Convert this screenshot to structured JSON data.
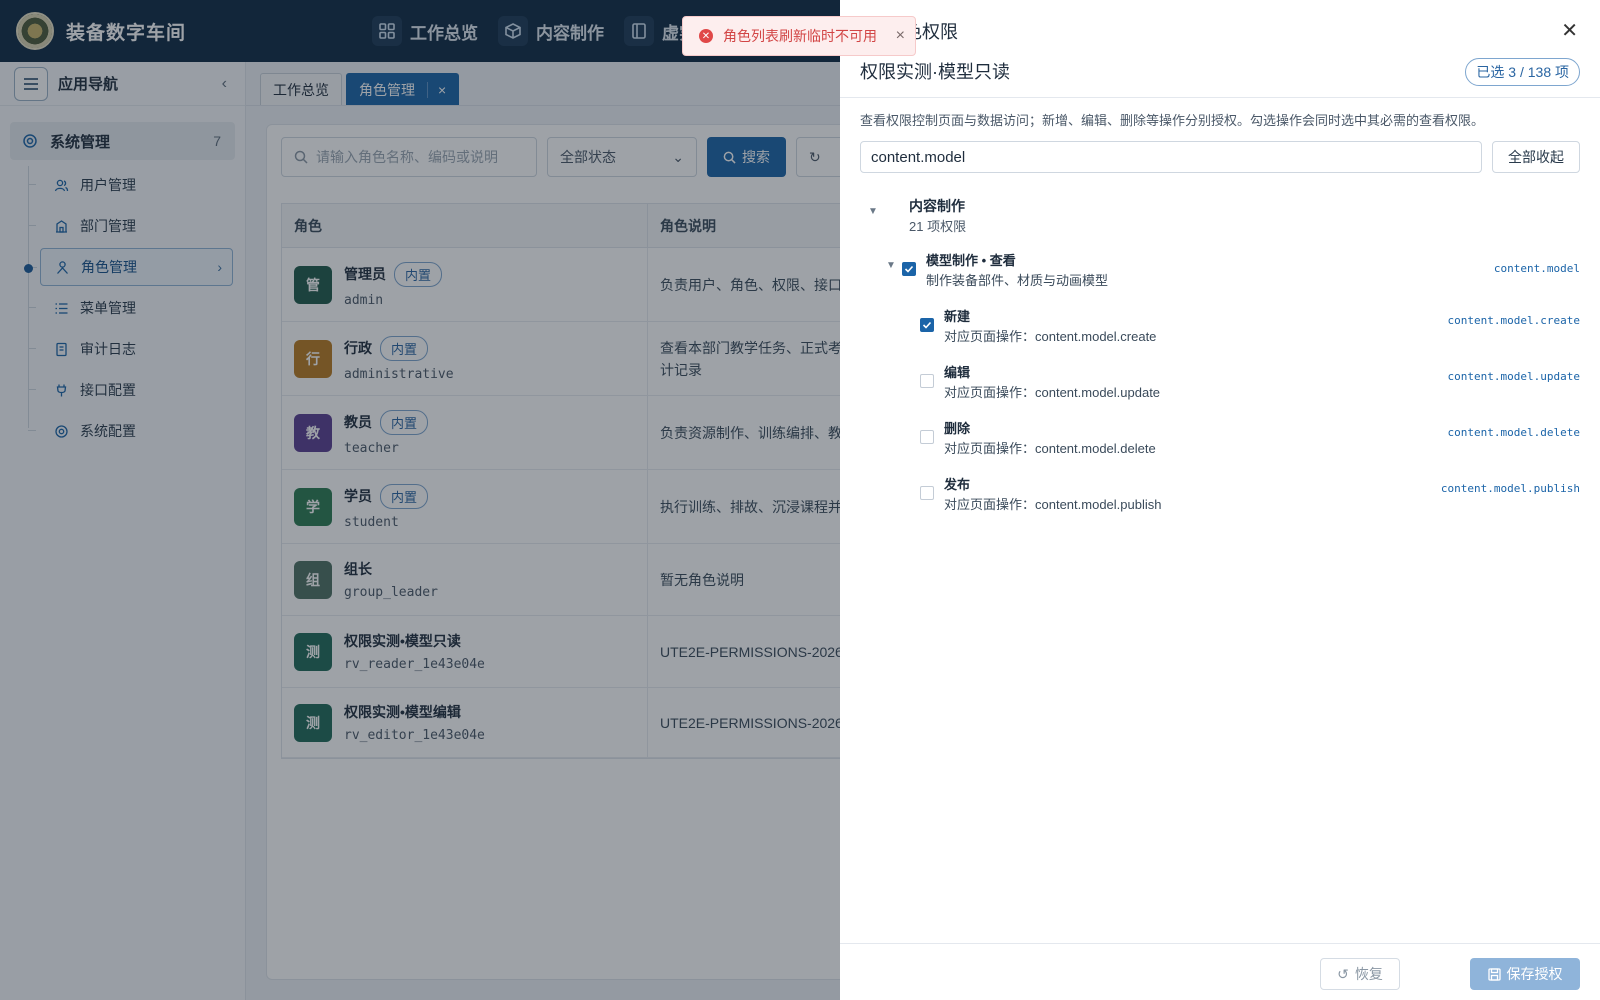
{
  "app": {
    "brand": "装备数字车间"
  },
  "topnav": [
    {
      "label": "工作总览",
      "icon": "grid-icon"
    },
    {
      "label": "内容制作",
      "icon": "cube-icon"
    },
    {
      "label": "虚实",
      "icon": "book-icon"
    }
  ],
  "sidebar": {
    "title": "应用导航",
    "group": {
      "label": "系统管理",
      "count": "7"
    },
    "items": [
      {
        "label": "用户管理",
        "icon": "users-icon"
      },
      {
        "label": "部门管理",
        "icon": "building-icon"
      },
      {
        "label": "角色管理",
        "icon": "role-icon",
        "active": true
      },
      {
        "label": "菜单管理",
        "icon": "list-icon"
      },
      {
        "label": "审计日志",
        "icon": "file-icon"
      },
      {
        "label": "接口配置",
        "icon": "plug-icon"
      },
      {
        "label": "系统配置",
        "icon": "gear-icon"
      }
    ]
  },
  "tabs": [
    {
      "label": "工作总览"
    },
    {
      "label": "角色管理",
      "active": true
    }
  ],
  "search": {
    "placeholder": "请输入角色名称、编码或说明",
    "status": "全部状态",
    "search_label": "搜索"
  },
  "table": {
    "headers": [
      "角色",
      "角色说明"
    ],
    "rows": [
      {
        "avatar": "管",
        "color": "#1f5a4a",
        "name": "管理员",
        "badge": "内置",
        "code": "admin",
        "desc": "负责用户、角色、权限、接口"
      },
      {
        "avatar": "行",
        "color": "#b87a22",
        "name": "行政",
        "badge": "内置",
        "code": "administrative",
        "desc": "查看本部门教学任务、正式考",
        "desc2": "计记录"
      },
      {
        "avatar": "教",
        "color": "#5b3f92",
        "name": "教员",
        "badge": "内置",
        "code": "teacher",
        "desc": "负责资源制作、训练编排、教"
      },
      {
        "avatar": "学",
        "color": "#2b7a52",
        "name": "学员",
        "badge": "内置",
        "code": "student",
        "desc": "执行训练、排故、沉浸课程并"
      },
      {
        "avatar": "组",
        "color": "#4e7163",
        "name": "组长",
        "badge": "",
        "code": "group_leader",
        "desc": "暂无角色说明"
      },
      {
        "avatar": "测",
        "color": "#1f6a58",
        "name": "权限实测•模型只读",
        "badge": "",
        "code": "rv_reader_1e43e04e",
        "desc": "UTE2E-PERMISSIONS-2026"
      },
      {
        "avatar": "测",
        "color": "#1f6a58",
        "name": "权限实测•模型编辑",
        "badge": "",
        "code": "rv_editor_1e43e04e",
        "desc": "UTE2E-PERMISSIONS-2026"
      }
    ]
  },
  "toast": {
    "message": "角色列表刷新临时不可用"
  },
  "drawer": {
    "title": "色权限",
    "role_name": "权限实测·模型只读",
    "selected": "已选 3 / 138 项",
    "description": "查看权限控制页面与数据访问；新增、编辑、删除等操作分别授权。勾选操作会同时选中其必需的查看权限。",
    "filter_value": "content.model",
    "collapse_all": "全部收起",
    "group": {
      "name": "内容制作",
      "count": "21 项权限"
    },
    "node": {
      "name": "模型制作 • 查看",
      "desc": "制作装备部件、材质与动画模型",
      "code": "content.model",
      "checked": true
    },
    "leaves": [
      {
        "name": "新建",
        "desc": "对应页面操作：content.model.create",
        "code": "content.model.create",
        "checked": true
      },
      {
        "name": "编辑",
        "desc": "对应页面操作：content.model.update",
        "code": "content.model.update",
        "checked": false
      },
      {
        "name": "删除",
        "desc": "对应页面操作：content.model.delete",
        "code": "content.model.delete",
        "checked": false
      },
      {
        "name": "发布",
        "desc": "对应页面操作：content.model.publish",
        "code": "content.model.publish",
        "checked": false
      }
    ],
    "restore_label": "恢复",
    "save_label": "保存授权"
  }
}
